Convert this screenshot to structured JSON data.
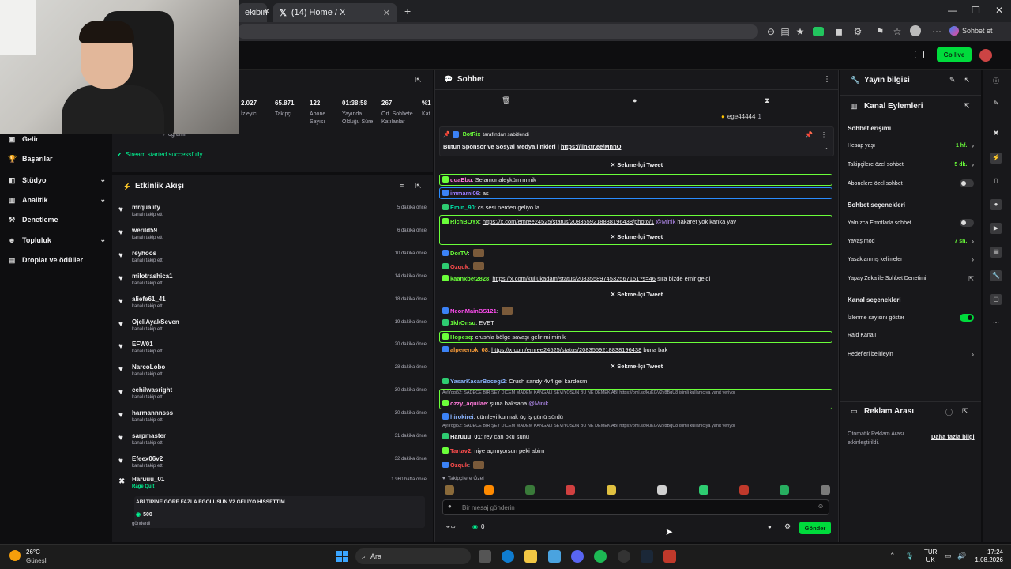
{
  "browser": {
    "tabs": [
      {
        "label": "ekibin"
      },
      {
        "label": "(14) Home / X"
      }
    ],
    "profile_label": "Sohbet et"
  },
  "topnav": {
    "go_live": "Go live"
  },
  "sidebar": {
    "items": [
      {
        "label": "Gelir",
        "icon": "revenue-icon"
      },
      {
        "label": "Başarılar",
        "icon": "trophy-icon"
      },
      {
        "label": "Stüdyo",
        "icon": "studio-icon",
        "expand": true
      },
      {
        "label": "Analitik",
        "icon": "analytics-icon",
        "expand": true
      },
      {
        "label": "Denetleme",
        "icon": "moderation-icon"
      },
      {
        "label": "Topluluk",
        "icon": "community-icon",
        "expand": true
      },
      {
        "label": "Droplar ve ödüller",
        "icon": "drops-icon"
      }
    ]
  },
  "stats": {
    "items": [
      {
        "value": "2.027",
        "label": "İzleyici"
      },
      {
        "value": "65.871",
        "label": "Takipçi"
      },
      {
        "value": "122",
        "label": "Abone Sayısı"
      },
      {
        "value": "01:38:58",
        "label": "Yayında Olduğu Süre"
      },
      {
        "value": "267",
        "label": "Ort. Sohbete Katılanlar"
      },
      {
        "value": "%1",
        "label": "Kat"
      }
    ],
    "program_label": "Programı",
    "stream_status": "Stream started successfully."
  },
  "feed": {
    "title": "Etkinlik Akışı",
    "items": [
      {
        "name": "mrquality",
        "sub": "kanalı takip etti",
        "time": "5 dakika önce"
      },
      {
        "name": "werild59",
        "sub": "kanalı takip etti",
        "time": "6 dakika önce"
      },
      {
        "name": "reyhoos",
        "sub": "kanalı takip etti",
        "time": "10 dakika önce"
      },
      {
        "name": "milotrashica1",
        "sub": "kanalı takip etti",
        "time": "14 dakika önce"
      },
      {
        "name": "aliefe61_41",
        "sub": "kanalı takip etti",
        "time": "18 dakika önce"
      },
      {
        "name": "OjeliAyakSeven",
        "sub": "kanalı takip etti",
        "time": "19 dakika önce"
      },
      {
        "name": "EFW01",
        "sub": "kanalı takip etti",
        "time": "20 dakika önce"
      },
      {
        "name": "NarcoLobo",
        "sub": "kanalı takip etti",
        "time": "28 dakika önce"
      },
      {
        "name": "cehilwasright",
        "sub": "kanalı takip etti",
        "time": "30 dakika önce"
      },
      {
        "name": "harmannnsss",
        "sub": "kanalı takip etti",
        "time": "30 dakika önce"
      },
      {
        "name": "sarpmaster",
        "sub": "kanalı takip etti",
        "time": "31 dakika önce"
      },
      {
        "name": "Efeex06v2",
        "sub": "kanalı takip etti",
        "time": "32 dakika önce"
      }
    ],
    "raid": {
      "name": "Haruuu_01",
      "sub": "Rage Quit",
      "time": "1.960 hafta önce",
      "message": "ABİ TİPİNE GÖRE FAZLA EGOLUSUN V2 GELİYO HİSSETTİM",
      "amount": "500",
      "sent": "gönderdi"
    }
  },
  "chat": {
    "title": "Sohbet",
    "top_user": "ege44444",
    "pinned": {
      "by": "BotRix",
      "by_suffix": "tarafından sabitlendi",
      "text": "Bütün Sponsor ve Sosyal Medya linkleri |",
      "link": "https://linktr.ee/MnnQ"
    },
    "tweet_label": "Sekme-İçi Tweet",
    "messages": [
      {
        "user": "quaEbu",
        "color": "#ff7ad9",
        "text": "Selamunaleyküm minik"
      },
      {
        "user": "immami06",
        "color": "#9b7bff",
        "text": "as"
      },
      {
        "user": "Emin_90",
        "color": "#00e0a8",
        "text": "cs sesi nerden geliyo la"
      },
      {
        "user": "RichBOYx",
        "color": "#6bff3a",
        "link": "https://x.com/emree24525/status/2083559218838196438/photo/1",
        "mention": "@Minik",
        "text": "hakaret yok kanka yav"
      },
      {
        "user": "DorTV",
        "color": "#6bff3a",
        "text": ""
      },
      {
        "user": "Ozquk",
        "color": "#ff4d4d",
        "text": ""
      },
      {
        "user": "kaanxbet2828",
        "color": "#6bff3a",
        "link": "https://x.com/kullukadam/status/2083558974532567151?s=46",
        "text": "sıra bizde emir geldi"
      },
      {
        "user": "NeonMainBS121",
        "color": "#ff4df0",
        "text": ""
      },
      {
        "user": "1khOnsu",
        "color": "#6bff3a",
        "text": "EVET"
      },
      {
        "user": "Hopesq",
        "color": "#6bff3a",
        "text": "crushla bölge savaşı gelir mi minik"
      },
      {
        "user": "alperenok_08",
        "color": "#ff9f3a",
        "link": "https://x.com/emree24525/status/2083559218838196438",
        "text": "buna bak"
      },
      {
        "user": "YasarKacarBocegi2",
        "color": "#8ab4ff",
        "text": "Crush sandy 4v4 gel kardesm"
      },
      {
        "reply": "AylYogi52: SADECE BİR ŞEY DİCEM MADEM KANGALI SEVİYOSUN BU NE DEMEK ABİ https://oml.sc/kuKGV2v8BqU8 isimli kullanıcıya yanıt veriyor",
        "user": "ozzy_aquilae",
        "color": "#ff7ad9",
        "text": "şuna baksana",
        "mention": "@Minik"
      },
      {
        "user": "hirokirei",
        "color": "#8ab4ff",
        "text": "cümleyi kurmak üç iş günü sürdü"
      },
      {
        "reply": "AylYogi52: SADECE BİR ŞEY DİCEM MADEM KANGALI SEVİYOSUN BU NE DEMEK ABİ https://oml.sc/kuKGV2v8BqU8 isimli kullanıcıya yanıt veriyor",
        "user": "Haruuu_01",
        "color": "#efeff1",
        "text": "rey can oku sunu"
      },
      {
        "user": "Tartav2",
        "color": "#ff4d4d",
        "text": "niye açmıyorsun peki abim"
      },
      {
        "user": "Ozquk",
        "color": "#ff4d4d",
        "text": ""
      }
    ],
    "followers_only": "Takipçilere Özel",
    "input_placeholder": "Bir mesaj gönderin",
    "points": "0",
    "send": "Gönder"
  },
  "stream_info": {
    "title": "Yayın bilgisi",
    "actions_title": "Kanal Eylemleri",
    "chat_access": "Sohbet erişimi",
    "rows1": [
      {
        "label": "Hesap yaşı",
        "value": "1 hf.",
        "type": "chevron"
      },
      {
        "label": "Takipçilere özel sohbet",
        "value": "5 dk.",
        "type": "chevron"
      },
      {
        "label": "Abonelere özel sohbet",
        "value": "",
        "type": "toggle-off"
      }
    ],
    "chat_options": "Sohbet seçenekleri",
    "rows2": [
      {
        "label": "Yalnızca Emotlarla sohbet",
        "value": "",
        "type": "toggle-off"
      },
      {
        "label": "Yavaş mod",
        "value": "7 sn.",
        "type": "chevron"
      },
      {
        "label": "Yasaklanmış kelimeler",
        "value": "",
        "type": "chevron"
      },
      {
        "label": "Yapay Zeka ile Sohbet Denetimi",
        "value": "",
        "type": "external"
      }
    ],
    "channel_options": "Kanal seçenekleri",
    "rows3": [
      {
        "label": "İzlenme sayısını göster",
        "value": "",
        "type": "toggle-on"
      },
      {
        "label": "Raid Kanalı",
        "value": "",
        "type": "none"
      },
      {
        "label": "Hedefleri belirleyin",
        "value": "",
        "type": "chevron"
      }
    ],
    "ads_title": "Reklam Arası",
    "ads_text": "Otomatik Reklam Arası etkinleştirildi.",
    "ads_more": "Daha fazla bilgi"
  },
  "taskbar": {
    "weather_temp": "26°C",
    "weather_text": "Güneşli",
    "search": "Ara",
    "lang1": "TUR",
    "lang2": "UK",
    "time": "17:24",
    "date": "1.08.2026"
  }
}
